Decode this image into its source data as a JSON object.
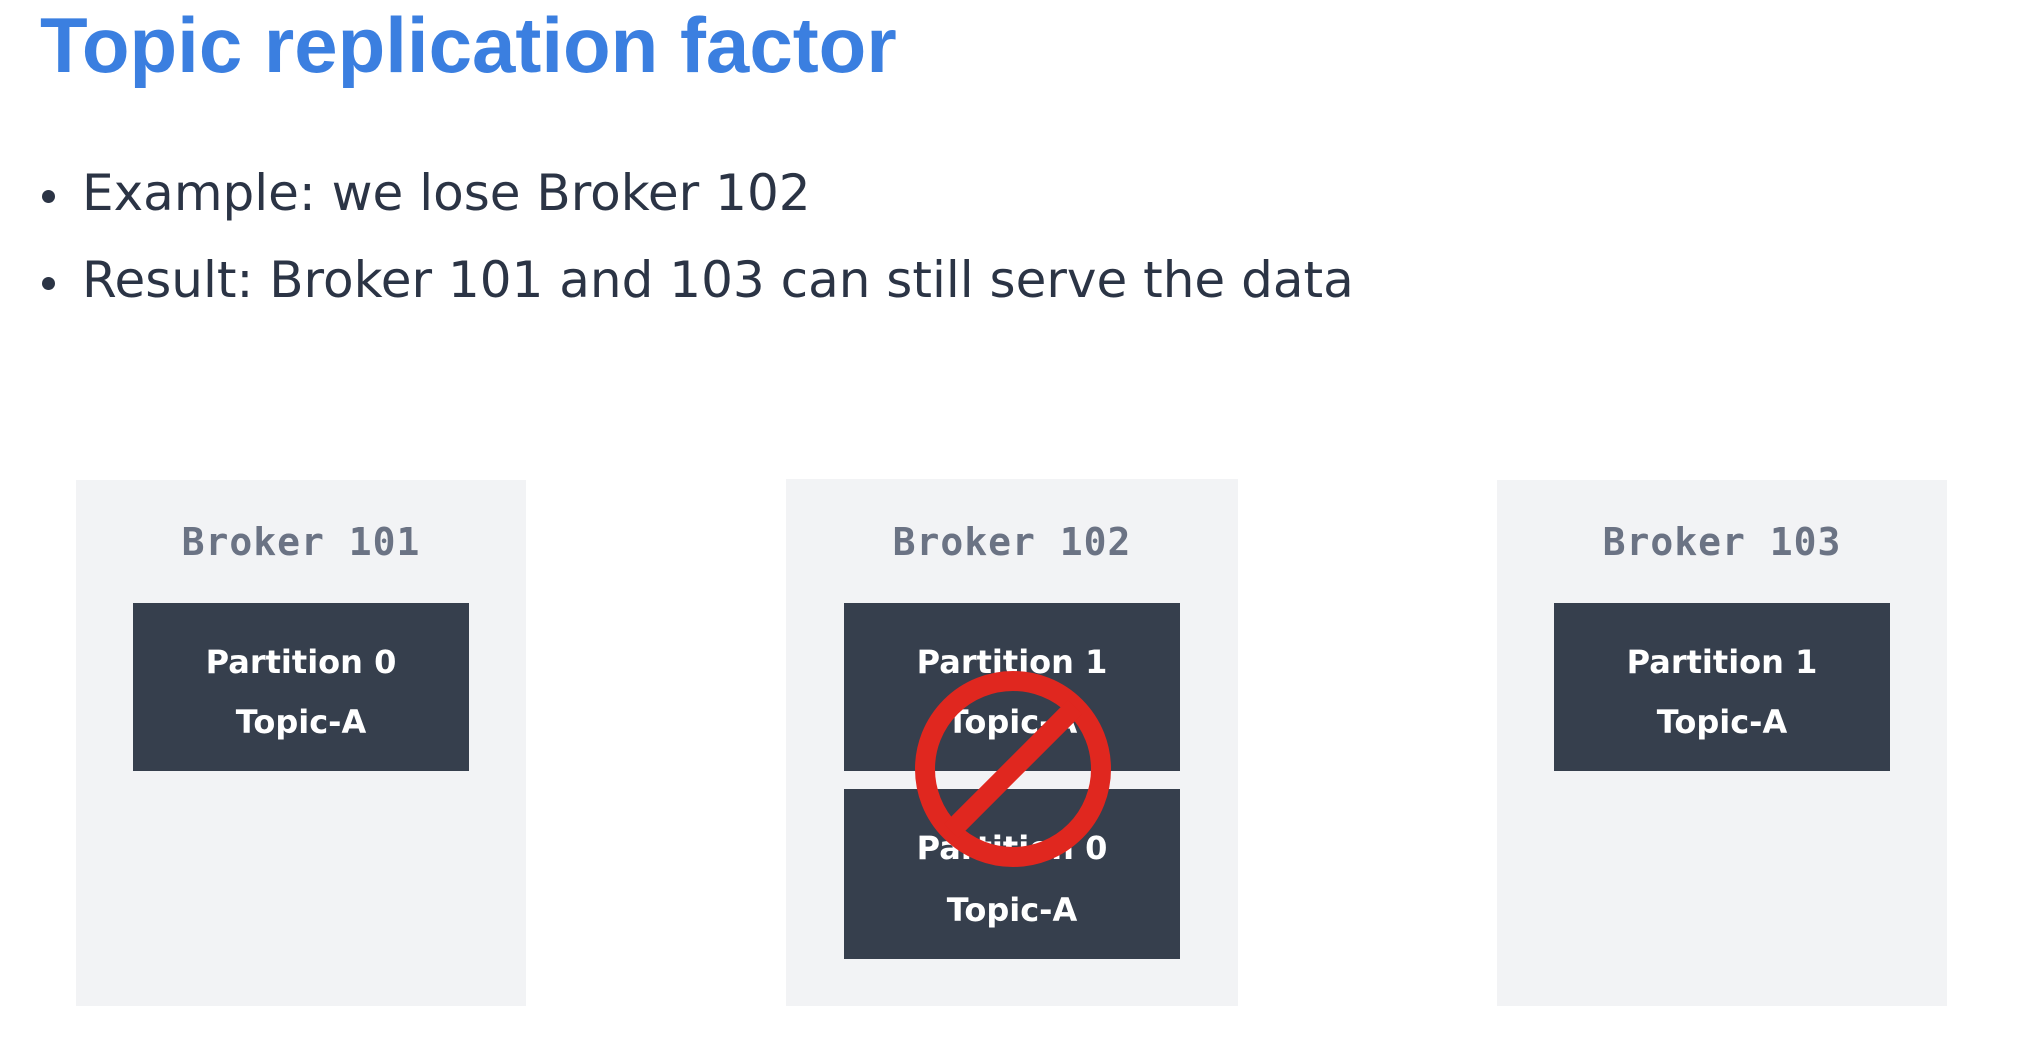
{
  "slide": {
    "title": "Topic replication factor",
    "bullets": [
      "Example: we lose Broker 102",
      "Result: Broker 101 and 103 can still serve the data"
    ]
  },
  "brokers": [
    {
      "label": "Broker 101",
      "partitions": [
        {
          "partition": "Partition 0",
          "topic": "Topic-A"
        }
      ]
    },
    {
      "label": "Broker 102",
      "status": "lost",
      "partitions": [
        {
          "partition": "Partition 1",
          "topic": "Topic-A"
        },
        {
          "partition": "Partition 0",
          "topic": "Topic-A"
        }
      ]
    },
    {
      "label": "Broker 103",
      "partitions": [
        {
          "partition": "Partition 1",
          "topic": "Topic-A"
        }
      ]
    }
  ],
  "icons": {
    "lost_marker": "prohibited-icon"
  },
  "colors": {
    "title": "#3b7fe0",
    "text": "#2b3445",
    "broker_bg": "#f2f3f5",
    "broker_label": "#6b7384",
    "partition_bg": "#363f4d",
    "partition_text": "#ffffff",
    "prohibited": "#e0271f"
  }
}
